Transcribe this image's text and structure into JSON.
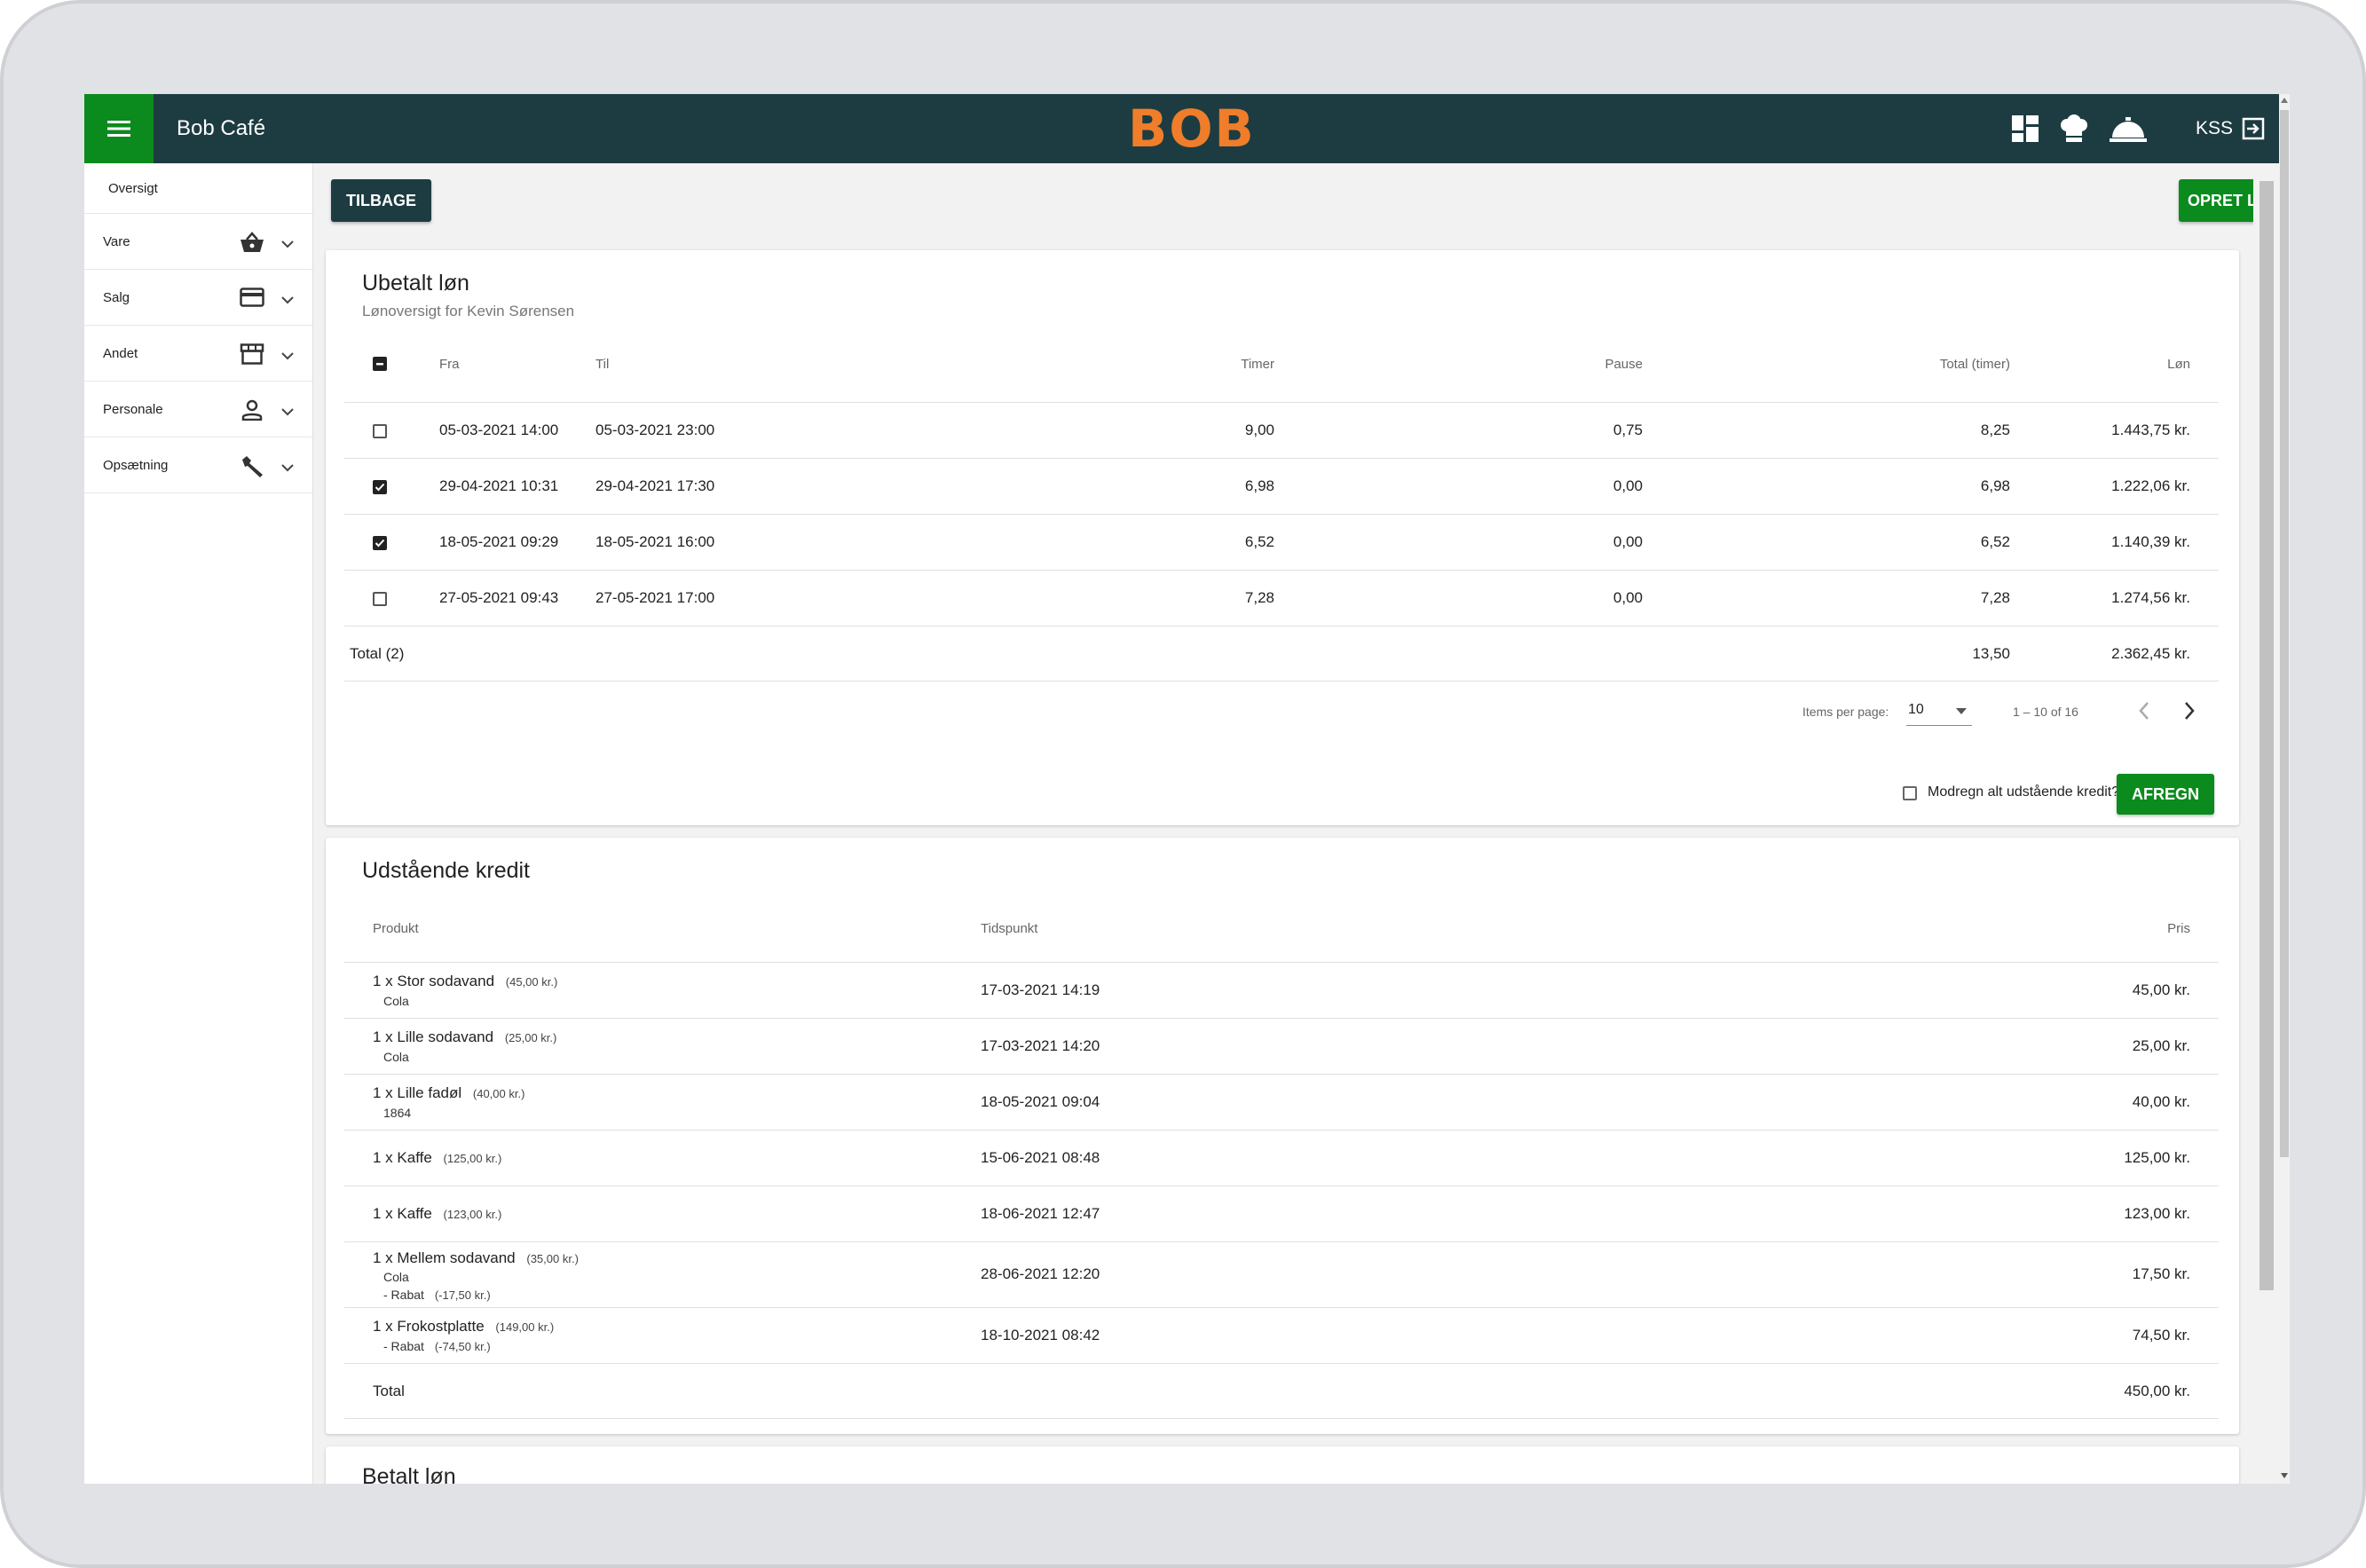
{
  "header": {
    "app_title": "Bob Café",
    "logo": "BOB",
    "user": "KSS",
    "icons": [
      "dashboard-icon",
      "chef-hat-icon",
      "service-bell-icon",
      "logout-icon"
    ]
  },
  "sidebar": {
    "items": [
      {
        "label": "Oversigt"
      },
      {
        "label": "Vare",
        "icon": "basket-icon"
      },
      {
        "label": "Salg",
        "icon": "credit-card-icon"
      },
      {
        "label": "Andet",
        "icon": "store-icon"
      },
      {
        "label": "Personale",
        "icon": "person-icon"
      },
      {
        "label": "Opsætning",
        "icon": "wrench-icon"
      }
    ]
  },
  "toolbar": {
    "back_label": "TILBAGE",
    "create_label": "OPRET LØNREGISTRERING"
  },
  "unpaid": {
    "title": "Ubetalt løn",
    "subtitle": "Lønoversigt for Kevin Sørensen",
    "columns": {
      "from": "Fra",
      "to": "Til",
      "hours": "Timer",
      "pause": "Pause",
      "total": "Total (timer)",
      "wage": "Løn"
    },
    "rows": [
      {
        "from": "05-03-2021 14:00",
        "to": "05-03-2021 23:00",
        "hours": "9,00",
        "pause": "0,75",
        "total": "8,25",
        "wage": "1.443,75 kr.",
        "checked": false
      },
      {
        "from": "29-04-2021 10:31",
        "to": "29-04-2021 17:30",
        "hours": "6,98",
        "pause": "0,00",
        "total": "6,98",
        "wage": "1.222,06 kr.",
        "checked": true
      },
      {
        "from": "18-05-2021 09:29",
        "to": "18-05-2021 16:00",
        "hours": "6,52",
        "pause": "0,00",
        "total": "6,52",
        "wage": "1.140,39 kr.",
        "checked": true
      },
      {
        "from": "27-05-2021 09:43",
        "to": "27-05-2021 17:00",
        "hours": "7,28",
        "pause": "0,00",
        "total": "7,28",
        "wage": "1.274,56 kr.",
        "checked": false
      }
    ],
    "total": {
      "label": "Total (2)",
      "hours": "13,50",
      "wage": "2.362,45 kr."
    },
    "pagination": {
      "items_label": "Items per page:",
      "per_page": "10",
      "range": "1 – 10 of 16"
    },
    "offset_label": "Modregn alt udstående kredit?",
    "settle_label": "AFREGN"
  },
  "credit": {
    "title": "Udstående kredit",
    "columns": {
      "product": "Produkt",
      "time": "Tidspunkt",
      "price": "Pris"
    },
    "rows": [
      {
        "product": "1 x Stor sodavand",
        "unit": "(45,00 kr.)",
        "sub": "Cola",
        "discount": "",
        "discount_amt": "",
        "time": "17-03-2021 14:19",
        "price": "45,00 kr."
      },
      {
        "product": "1 x Lille sodavand",
        "unit": "(25,00 kr.)",
        "sub": "Cola",
        "discount": "",
        "discount_amt": "",
        "time": "17-03-2021 14:20",
        "price": "25,00 kr."
      },
      {
        "product": "1 x Lille fadøl",
        "unit": "(40,00 kr.)",
        "sub": "1864",
        "discount": "",
        "discount_amt": "",
        "time": "18-05-2021 09:04",
        "price": "40,00 kr."
      },
      {
        "product": "1 x Kaffe",
        "unit": "(125,00 kr.)",
        "sub": "",
        "discount": "",
        "discount_amt": "",
        "time": "15-06-2021 08:48",
        "price": "125,00 kr."
      },
      {
        "product": "1 x Kaffe",
        "unit": "(123,00 kr.)",
        "sub": "",
        "discount": "",
        "discount_amt": "",
        "time": "18-06-2021 12:47",
        "price": "123,00 kr."
      },
      {
        "product": "1 x Mellem sodavand",
        "unit": "(35,00 kr.)",
        "sub": "Cola",
        "discount": "- Rabat",
        "discount_amt": "(-17,50 kr.)",
        "time": "28-06-2021 12:20",
        "price": "17,50 kr."
      },
      {
        "product": "1 x Frokostplatte",
        "unit": "(149,00 kr.)",
        "sub": "",
        "discount": "- Rabat",
        "discount_amt": "(-74,50 kr.)",
        "time": "18-10-2021 08:42",
        "price": "74,50 kr."
      }
    ],
    "total": {
      "label": "Total",
      "price": "450,00 kr."
    }
  },
  "paid": {
    "title": "Betalt løn"
  }
}
